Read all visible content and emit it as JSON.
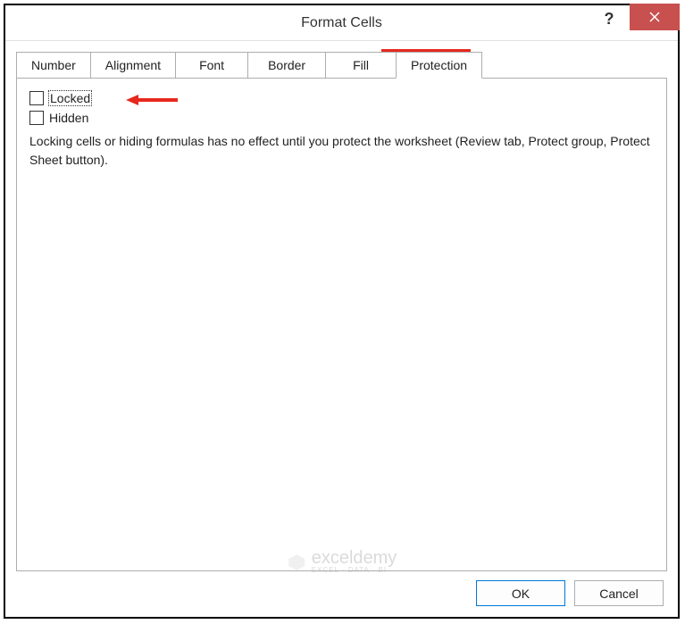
{
  "dialog": {
    "title": "Format Cells",
    "help_icon": "?",
    "close_icon": "close"
  },
  "tabs": [
    {
      "label": "Number"
    },
    {
      "label": "Alignment"
    },
    {
      "label": "Font"
    },
    {
      "label": "Border"
    },
    {
      "label": "Fill"
    },
    {
      "label": "Protection",
      "active": true
    }
  ],
  "protection": {
    "locked_label": "Locked",
    "hidden_label": "Hidden",
    "info_text": "Locking cells or hiding formulas has no effect until you protect the worksheet (Review tab, Protect group, Protect Sheet button)."
  },
  "buttons": {
    "ok": "OK",
    "cancel": "Cancel"
  },
  "watermark": {
    "brand": "exceldemy",
    "tagline": "EXCEL · DATA · BI"
  },
  "colors": {
    "highlight": "#e7281e",
    "close_bg": "#c8504f"
  }
}
